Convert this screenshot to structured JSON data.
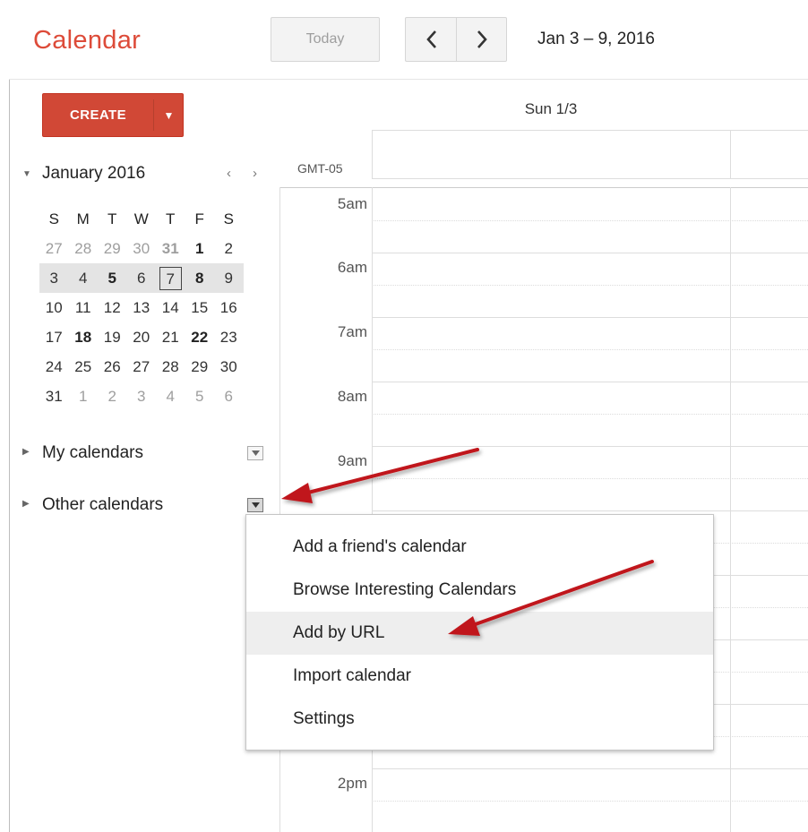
{
  "header": {
    "app_title": "Calendar",
    "today_label": "Today",
    "date_range": "Jan 3 – 9, 2016"
  },
  "sidebar": {
    "create_label": "CREATE",
    "create_arrow": "▼",
    "mini_calendar": {
      "title": "January 2016",
      "prev": "‹",
      "next": "›",
      "dow": [
        "S",
        "M",
        "T",
        "W",
        "T",
        "F",
        "S"
      ],
      "weeks": [
        [
          "27",
          "28",
          "29",
          "30",
          "31",
          "1",
          "2"
        ],
        [
          "3",
          "4",
          "5",
          "6",
          "7",
          "8",
          "9"
        ],
        [
          "10",
          "11",
          "12",
          "13",
          "14",
          "15",
          "16"
        ],
        [
          "17",
          "18",
          "19",
          "20",
          "21",
          "22",
          "23"
        ],
        [
          "24",
          "25",
          "26",
          "27",
          "28",
          "29",
          "30"
        ],
        [
          "31",
          "1",
          "2",
          "3",
          "4",
          "5",
          "6"
        ]
      ]
    },
    "my_calendars": "My calendars",
    "other_calendars": "Other calendars"
  },
  "main": {
    "day_header": "Sun 1/3",
    "timezone": "GMT-05",
    "hours": [
      "5am",
      "6am",
      "7am",
      "8am",
      "9am",
      "2pm"
    ]
  },
  "menu": {
    "items": [
      "Add a friend's calendar",
      "Browse Interesting Calendars",
      "Add by URL",
      "Import calendar",
      "Settings"
    ]
  },
  "colors": {
    "accent": "#dd4b39",
    "create_bg": "#d14836",
    "annotation_arrow": "#c0171b"
  }
}
